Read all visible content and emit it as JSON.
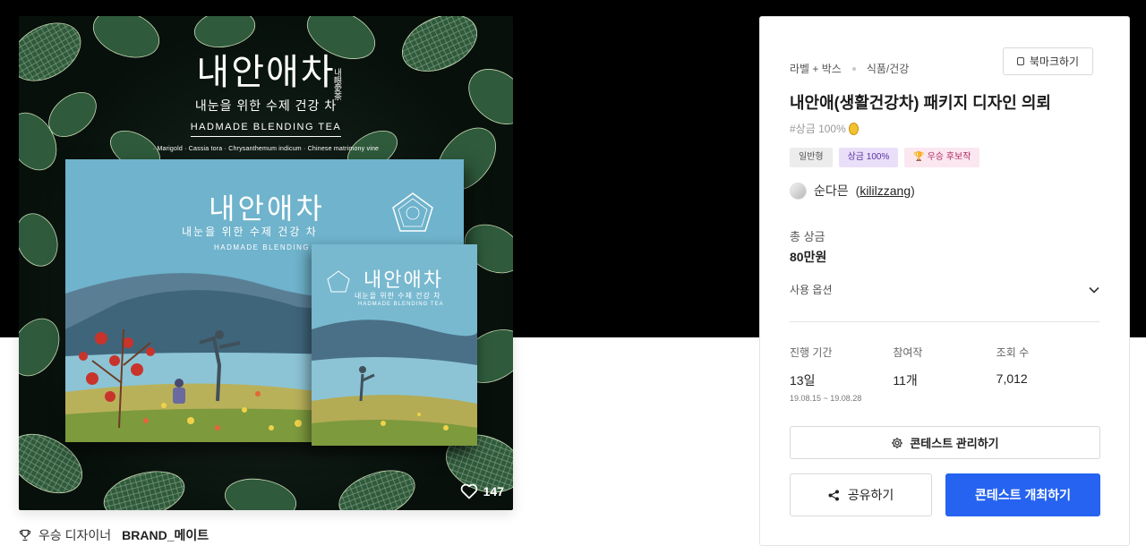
{
  "hero": {
    "title": "내안애차",
    "title_side": "내眼愛茶",
    "subtitle": "내눈을 위한 수제 건강 차",
    "english": "HADMADE BLENDING TEA",
    "ingredients": "· Marigold   · Cassia tora   · Chrysanthemum indicum   · Chinese matrimony vine",
    "likes": "147"
  },
  "winner": {
    "label": "우승 디자이너",
    "name": "BRAND_메이트"
  },
  "panel": {
    "breadcrumb": [
      "라벨 + 박스",
      "식품/건강"
    ],
    "bookmark_label": "북마크하기",
    "title": "내안애(생활건강차) 패키지 디자인 의뢰",
    "tagline": "#상금 100%",
    "badges": {
      "type": "일반형",
      "prize": "상금 100%",
      "winner": "우승 후보작"
    },
    "author_name": "순다믄",
    "author_id": "kililzzang",
    "prize_label": "총 상금",
    "prize_value": "80만원",
    "usage_label": "사용 옵션",
    "stats": {
      "period_label": "진행 기간",
      "period_value": "13일",
      "period_range": "19.08.15 ~ 19.08.28",
      "entries_label": "참여작",
      "entries_value": "11개",
      "views_label": "조회 수",
      "views_value": "7,012"
    },
    "manage_button": "콘테스트 관리하기",
    "share_button": "공유하기",
    "open_button": "콘테스트 개최하기"
  },
  "colors": {
    "accent": "#2563f0",
    "box_blue": "#6fb3cc"
  }
}
